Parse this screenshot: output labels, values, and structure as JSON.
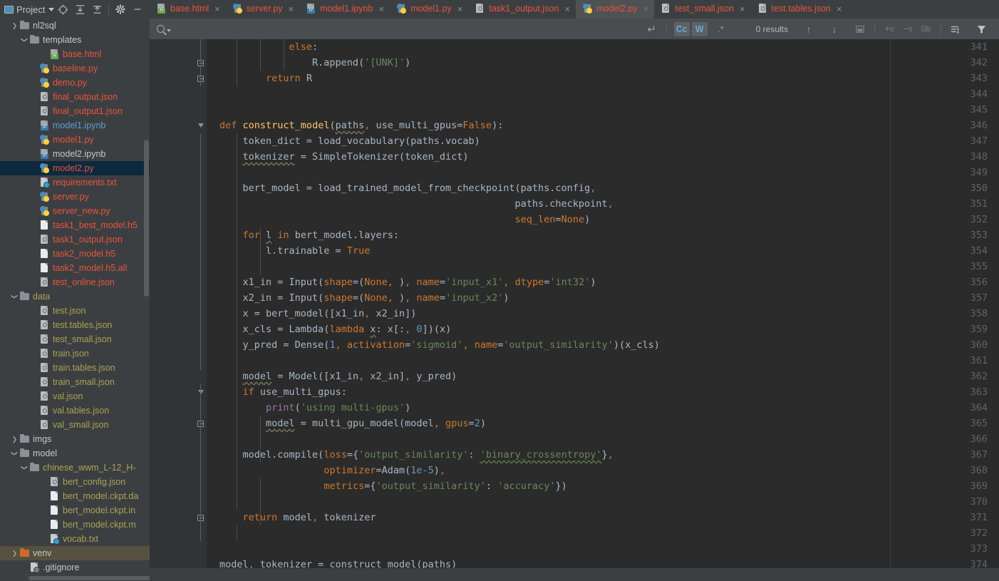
{
  "window": {
    "project_label": "Project",
    "toolbar_icons": [
      "project-view-icon",
      "locate-icon",
      "expand-all-icon",
      "collapse-all-icon",
      "settings-gear-icon",
      "hide-icon"
    ]
  },
  "tabs": [
    {
      "label": "base.html",
      "icon": "html-file-icon",
      "kind": "html",
      "active": false,
      "close": "×"
    },
    {
      "label": "server.py",
      "icon": "python-file-icon",
      "kind": "py",
      "active": false,
      "close": "×"
    },
    {
      "label": "model1.ipynb",
      "icon": "notebook-file-icon",
      "kind": "ipynb",
      "active": false,
      "close": "×"
    },
    {
      "label": "model1.py",
      "icon": "python-file-icon",
      "kind": "py",
      "active": false,
      "close": "×"
    },
    {
      "label": "task1_output.json",
      "icon": "json-file-icon",
      "kind": "json",
      "active": false,
      "close": "×"
    },
    {
      "label": "model2.py",
      "icon": "python-file-icon",
      "kind": "py",
      "active": true,
      "close": "×"
    },
    {
      "label": "test_small.json",
      "icon": "json-file-icon",
      "kind": "json",
      "active": false,
      "close": "×"
    },
    {
      "label": "test.tables.json",
      "icon": "json-file-icon",
      "kind": "json",
      "active": false,
      "close": "×"
    }
  ],
  "find_bar": {
    "query": "",
    "placeholder": "",
    "results_text": "0 results",
    "toggles": [
      {
        "name": "match-case-toggle",
        "label": "Cc",
        "active": true
      },
      {
        "name": "words-toggle",
        "label": "W",
        "active": true
      },
      {
        "name": "regex-toggle",
        "label": ".*",
        "active": false
      }
    ],
    "buttons": [
      {
        "name": "multiline-toggle-icon",
        "label": "↵"
      },
      {
        "name": "prev-occurrence-icon",
        "label": "↑"
      },
      {
        "name": "next-occurrence-icon",
        "label": "↓"
      },
      {
        "name": "select-all-occurrences-icon",
        "label": "▣"
      },
      {
        "name": "add-line-icon",
        "label": "+"
      },
      {
        "name": "remove-line-icon",
        "label": "−"
      },
      {
        "name": "check-line-icon",
        "label": "☑"
      },
      {
        "name": "filter-options-icon",
        "label": "≣"
      },
      {
        "name": "filter-icon",
        "label": "▼"
      }
    ]
  },
  "project_tree": [
    {
      "label": "nl2sql",
      "indent": 1,
      "type": "folder",
      "arrow": "collapsed",
      "color": "cwhite"
    },
    {
      "label": "templates",
      "indent": 2,
      "type": "folder",
      "arrow": "expanded",
      "color": "cwhite"
    },
    {
      "label": "base.html",
      "indent": 4,
      "type": "html",
      "arrow": "none",
      "color": "cred"
    },
    {
      "label": "baseline.py",
      "indent": 3,
      "type": "py",
      "arrow": "none",
      "color": "cred"
    },
    {
      "label": "demo.py",
      "indent": 3,
      "type": "py",
      "arrow": "none",
      "color": "cred"
    },
    {
      "label": "final_output.json",
      "indent": 3,
      "type": "json",
      "arrow": "none",
      "color": "cred"
    },
    {
      "label": "final_output1.json",
      "indent": 3,
      "type": "json",
      "arrow": "none",
      "color": "cred"
    },
    {
      "label": "model1.ipynb",
      "indent": 3,
      "type": "ipynb",
      "arrow": "none",
      "color": "cblue"
    },
    {
      "label": "model1.py",
      "indent": 3,
      "type": "py",
      "arrow": "none",
      "color": "cred"
    },
    {
      "label": "model2.ipynb",
      "indent": 3,
      "type": "ipynb",
      "arrow": "none",
      "color": "cwhite"
    },
    {
      "label": "model2.py",
      "indent": 3,
      "type": "py",
      "arrow": "none",
      "color": "cred",
      "selected": true
    },
    {
      "label": "requirements.txt",
      "indent": 3,
      "type": "cfg",
      "arrow": "none",
      "color": "cred"
    },
    {
      "label": "server.py",
      "indent": 3,
      "type": "py",
      "arrow": "none",
      "color": "cred"
    },
    {
      "label": "server_new.py",
      "indent": 3,
      "type": "py",
      "arrow": "none",
      "color": "cred"
    },
    {
      "label": "task1_best_model.h5",
      "indent": 3,
      "type": "file",
      "arrow": "none",
      "color": "cred"
    },
    {
      "label": "task1_output.json",
      "indent": 3,
      "type": "json",
      "arrow": "none",
      "color": "cred"
    },
    {
      "label": "task2_model.h5",
      "indent": 3,
      "type": "file",
      "arrow": "none",
      "color": "cred"
    },
    {
      "label": "task2_model.h5.all",
      "indent": 3,
      "type": "file",
      "arrow": "none",
      "color": "cred"
    },
    {
      "label": "test_online.json",
      "indent": 3,
      "type": "json",
      "arrow": "none",
      "color": "cred"
    },
    {
      "label": "data",
      "indent": 1,
      "type": "folder",
      "arrow": "expanded",
      "color": "cgold"
    },
    {
      "label": "test.json",
      "indent": 3,
      "type": "json",
      "arrow": "none",
      "color": "cgold"
    },
    {
      "label": "test.tables.json",
      "indent": 3,
      "type": "json",
      "arrow": "none",
      "color": "cgold"
    },
    {
      "label": "test_small.json",
      "indent": 3,
      "type": "json",
      "arrow": "none",
      "color": "cgold"
    },
    {
      "label": "train.json",
      "indent": 3,
      "type": "json",
      "arrow": "none",
      "color": "cgold"
    },
    {
      "label": "train.tables.json",
      "indent": 3,
      "type": "json",
      "arrow": "none",
      "color": "cgold"
    },
    {
      "label": "train_small.json",
      "indent": 3,
      "type": "json",
      "arrow": "none",
      "color": "cgold"
    },
    {
      "label": "val.json",
      "indent": 3,
      "type": "json",
      "arrow": "none",
      "color": "cgold"
    },
    {
      "label": "val.tables.json",
      "indent": 3,
      "type": "json",
      "arrow": "none",
      "color": "cgold"
    },
    {
      "label": "val_small.json",
      "indent": 3,
      "type": "json",
      "arrow": "none",
      "color": "cgold"
    },
    {
      "label": "imgs",
      "indent": 1,
      "type": "folder",
      "arrow": "collapsed",
      "color": "cwhite"
    },
    {
      "label": "model",
      "indent": 1,
      "type": "folder",
      "arrow": "expanded",
      "color": "cwhite"
    },
    {
      "label": "chinese_wwm_L-12_H-",
      "indent": 2,
      "type": "folder",
      "arrow": "expanded",
      "color": "cgold"
    },
    {
      "label": "bert_config.json",
      "indent": 4,
      "type": "json",
      "arrow": "none",
      "color": "cgold"
    },
    {
      "label": "bert_model.ckpt.da",
      "indent": 4,
      "type": "file",
      "arrow": "none",
      "color": "cgold"
    },
    {
      "label": "bert_model.ckpt.in",
      "indent": 4,
      "type": "file",
      "arrow": "none",
      "color": "cgold"
    },
    {
      "label": "bert_model.ckpt.m",
      "indent": 4,
      "type": "file",
      "arrow": "none",
      "color": "cgold"
    },
    {
      "label": "vocab.txt",
      "indent": 4,
      "type": "cfg",
      "arrow": "none",
      "color": "cgold"
    },
    {
      "label": "venv",
      "indent": 1,
      "type": "folder-orange",
      "arrow": "collapsed",
      "color": "cwhite",
      "highlighted": true
    },
    {
      "label": ".gitignore",
      "indent": 2,
      "type": "git",
      "arrow": "none",
      "color": "cwhite"
    }
  ],
  "editor": {
    "file": "model2.py",
    "first_line_number": 341,
    "code_lines": [
      {
        "n": 341,
        "html": "            <span class='k'>else</span>:",
        "fold": "none"
      },
      {
        "n": 342,
        "html": "                R.append(<span class='s'>'[UNK]'</span>)",
        "fold": "box"
      },
      {
        "n": 343,
        "html": "        <span class='k'>return</span> R",
        "fold": "box"
      },
      {
        "n": 344,
        "html": "",
        "fold": "none"
      },
      {
        "n": 345,
        "html": "",
        "fold": "none"
      },
      {
        "n": 346,
        "html": "<span class='k'>def</span> <span class='fn'>construct_model</span>(<span class='wavy'>paths</span><span class='k'>,</span> use_multi_gpus=<span class='k'>False</span>):",
        "fold": "tri"
      },
      {
        "n": 347,
        "html": "    token_dict = load_vocabulary(paths.vocab)",
        "fold": "none"
      },
      {
        "n": 348,
        "html": "    <span class='wavy'>tokenizer</span> = SimpleTokenizer(token_dict)",
        "fold": "none"
      },
      {
        "n": 349,
        "html": "",
        "fold": "none"
      },
      {
        "n": 350,
        "html": "    bert_model = load_trained_model_from_checkpoint(paths.config<span class='k'>,</span>",
        "fold": "none"
      },
      {
        "n": 351,
        "html": "                                                   paths.checkpoint<span class='k'>,</span>",
        "fold": "none"
      },
      {
        "n": 352,
        "html": "                                                   <span class='k'>seq_len</span>=<span class='k'>None</span>)",
        "fold": "none"
      },
      {
        "n": 353,
        "html": "    <span class='k'>for</span> <span class='wavy'>l</span> <span class='k'>in</span> bert_model.layers:",
        "fold": "none"
      },
      {
        "n": 354,
        "html": "        l.trainable = <span class='k'>True</span>",
        "fold": "none"
      },
      {
        "n": 355,
        "html": "",
        "fold": "none"
      },
      {
        "n": 356,
        "html": "    x1_in = Input(<span class='k'>shape</span>=(<span class='k'>None</span><span class='k'>,</span> )<span class='k'>,</span> <span class='k'>name</span>=<span class='s'>'input_x1'</span><span class='k'>,</span> <span class='k'>dtype</span>=<span class='s'>'int32'</span>)",
        "fold": "none"
      },
      {
        "n": 357,
        "html": "    x2_in = Input(<span class='k'>shape</span>=(<span class='k'>None</span><span class='k'>,</span> )<span class='k'>,</span> <span class='k'>name</span>=<span class='s'>'input_x2'</span>)",
        "fold": "none"
      },
      {
        "n": 358,
        "html": "    x = bert_model([x1_in<span class='k'>,</span> x2_in])",
        "fold": "none"
      },
      {
        "n": 359,
        "html": "    x_cls = Lambda(<span class='k'>lambda</span> <span class='wavy'>x</span>: x[:<span class='k'>,</span> <span class='n'>0</span>])(x)",
        "fold": "none"
      },
      {
        "n": 360,
        "html": "    y_pred = Dense(<span class='n'>1</span><span class='k'>,</span> <span class='k'>activation</span>=<span class='s'>'sigmoid'</span><span class='k'>,</span> <span class='k'>name</span>=<span class='s'>'output_similarity'</span>)(x_cls)",
        "fold": "none"
      },
      {
        "n": 361,
        "html": "",
        "fold": "none"
      },
      {
        "n": 362,
        "html": "    <span class='wavy'>model</span> = Model([x1_in<span class='k'>,</span> x2_in]<span class='k'>,</span> y_pred)",
        "fold": "none"
      },
      {
        "n": 363,
        "html": "    <span class='k'>if</span> use_multi_gpus:",
        "fold": "tri"
      },
      {
        "n": 364,
        "html": "        <span class='p'>print</span>(<span class='s'>'using multi-gpus'</span>)",
        "fold": "none"
      },
      {
        "n": 365,
        "html": "        <span class='wavy'>model</span> = multi_gpu_model(model<span class='k'>,</span> <span class='k'>gpus</span>=<span class='n'>2</span>)",
        "fold": "box"
      },
      {
        "n": 366,
        "html": "",
        "fold": "none"
      },
      {
        "n": 367,
        "html": "    model.compile(<span class='k'>loss</span>={<span class='s'>'output_similarity'</span>: <span class='s wavyg'>'binary_crossentropy'</span>}<span class='k'>,</span>",
        "fold": "none"
      },
      {
        "n": 368,
        "html": "                  <span class='k'>optimizer</span>=Adam(<span class='n'>1e-5</span>)<span class='k'>,</span>",
        "fold": "none"
      },
      {
        "n": 369,
        "html": "                  <span class='k'>metrics</span>={<span class='s'>'output_similarity'</span>: <span class='s'>'accuracy'</span>})",
        "fold": "none"
      },
      {
        "n": 370,
        "html": "",
        "fold": "none"
      },
      {
        "n": 371,
        "html": "    <span class='k'>return</span> model<span class='k'>,</span> tokenizer",
        "fold": "box"
      },
      {
        "n": 372,
        "html": "",
        "fold": "none"
      },
      {
        "n": 373,
        "html": "",
        "fold": "none"
      },
      {
        "n": 374,
        "html": "model<span class='k'>,</span> tokenizer = construct_model(paths)",
        "fold": "none"
      }
    ]
  },
  "colors": {
    "bg_chrome": "#3c3f41",
    "bg_editor": "#2b2b2b",
    "bg_gutter": "#313335",
    "tab_active": "#4e5254",
    "find_bar": "#4a4d4f",
    "selection": "#0d293e",
    "highlight": "#55503f",
    "accent_red": "#e8533f",
    "accent_gold": "#a9a356",
    "accent_blue": "#5b9bd5",
    "keyword": "#cc7832",
    "string": "#6a8759",
    "number": "#6897bb",
    "function": "#ffc66d",
    "builtin": "#9876aa",
    "text": "#a9b7c6"
  }
}
